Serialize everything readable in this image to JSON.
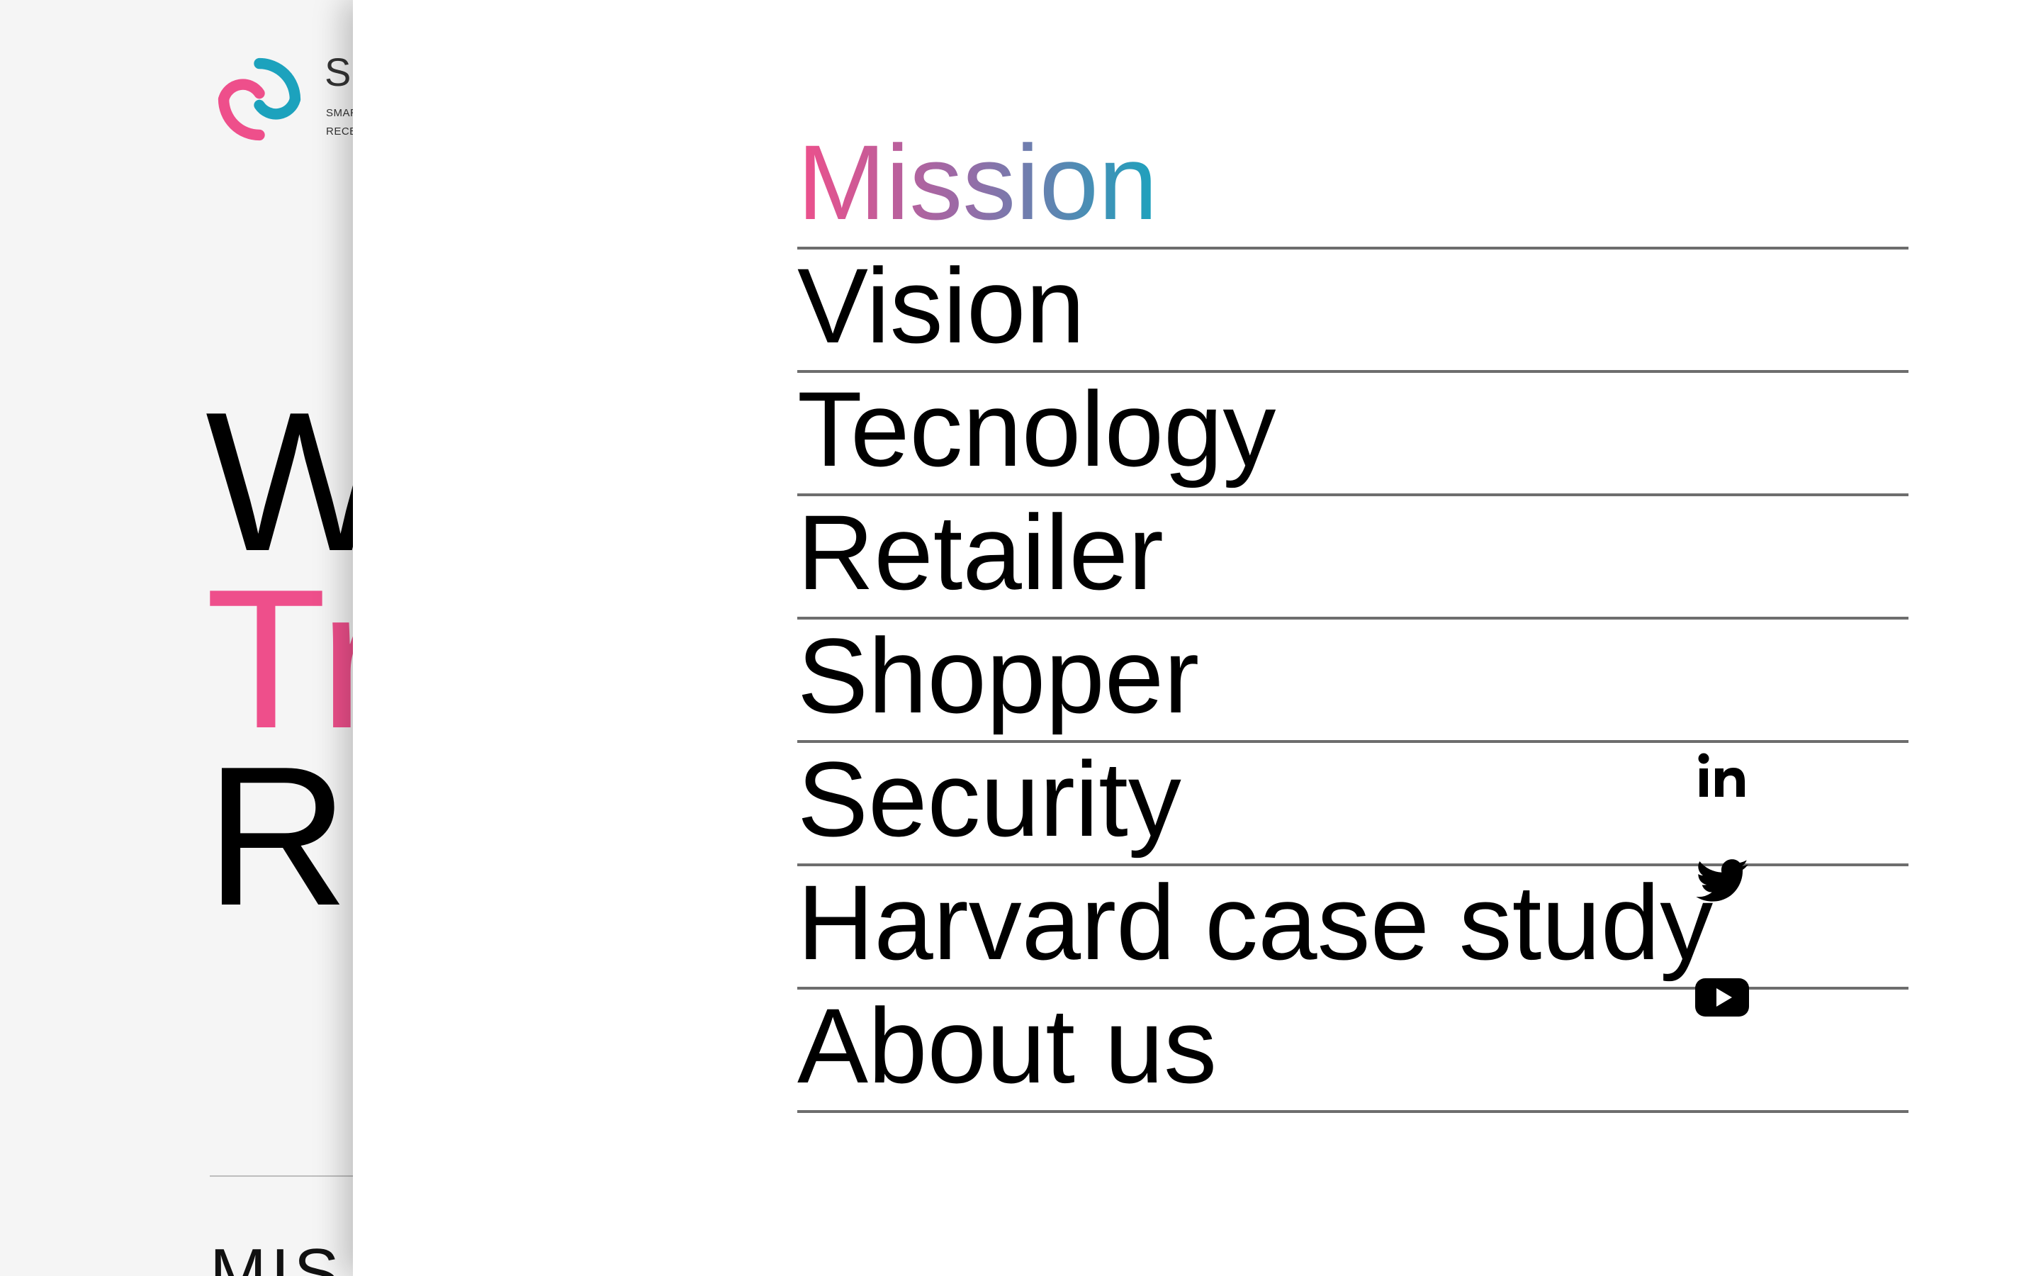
{
  "background_page": {
    "brand_initial": "S",
    "brand_sub_line1": "SMAR",
    "brand_sub_line2": "RECE",
    "hero_line1": "W",
    "hero_line2": "Tr",
    "hero_line3": "R",
    "section_heading": "MIS",
    "colors": {
      "accent_pink": "#ee4f8b",
      "accent_teal": "#1ca2bd"
    }
  },
  "menu": {
    "items": [
      {
        "label": "Mission",
        "active": true
      },
      {
        "label": "Vision",
        "active": false
      },
      {
        "label": "Tecnology",
        "active": false
      },
      {
        "label": "Retailer",
        "active": false
      },
      {
        "label": "Shopper",
        "active": false
      },
      {
        "label": "Security",
        "active": false
      },
      {
        "label": "Harvard case study",
        "active": false
      },
      {
        "label": "About us",
        "active": false
      }
    ],
    "close_icon": "close-icon",
    "active_gradient": [
      "#ee4f8b",
      "#1ca2bd"
    ]
  },
  "social": [
    {
      "icon": "linkedin-icon"
    },
    {
      "icon": "twitter-icon"
    },
    {
      "icon": "youtube-icon"
    }
  ]
}
